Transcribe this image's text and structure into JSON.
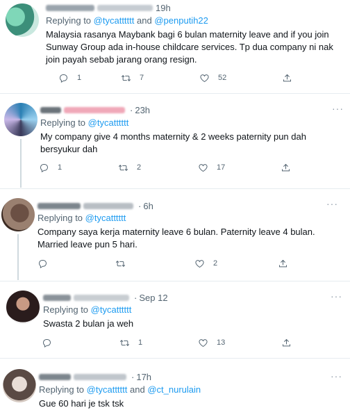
{
  "tweets": [
    {
      "time": "19h",
      "replying_label": "Replying to",
      "mention_1": "@tycatttttt",
      "joiner": "and",
      "mention_2": "@penputih22",
      "text": "Malaysia rasanya Maybank bagi 6 bulan maternity leave and if you join Sunway Group ada in-house childcare services. Tp dua company ni nak join payah sebab jarang orang resign.",
      "replies": "1",
      "retweets": "7",
      "likes": "52"
    },
    {
      "time": "23h",
      "replying_label": "Replying to",
      "mention_1": "@tycatttttt",
      "text": "My company give 4 months maternity & 2 weeks paternity pun dah bersyukur dah",
      "replies": "1",
      "retweets": "2",
      "likes": "17"
    },
    {
      "time": "6h",
      "replying_label": "Replying to",
      "mention_1": "@tycatttttt",
      "text": "Company saya kerja maternity leave 6 bulan. Paternity leave 4 bulan. Married leave pun 5 hari.",
      "replies": "",
      "retweets": "",
      "likes": "2"
    },
    {
      "time": "Sep 12",
      "replying_label": "Replying to",
      "mention_1": "@tycatttttt",
      "text": "Swasta 2 bulan ja weh",
      "replies": "",
      "retweets": "1",
      "likes": "13"
    },
    {
      "time": "17h",
      "replying_label": "Replying to",
      "mention_1": "@tycatttttt",
      "joiner": "and",
      "mention_2": "@ct_nurulain",
      "text": "Gue 60 hari je tsk tsk"
    }
  ],
  "icons": {
    "reply": "reply-icon",
    "retweet": "retweet-icon",
    "like": "heart-icon",
    "share": "share-icon",
    "more": "more-icon"
  },
  "colors": {
    "link": "#1d9bf0",
    "muted": "#536471",
    "divider": "#e6ecf0"
  }
}
